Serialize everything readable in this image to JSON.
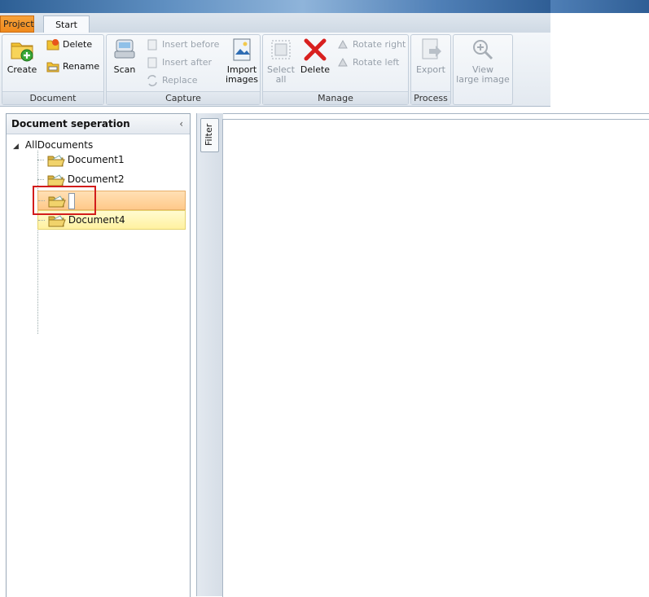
{
  "tabs": {
    "project": "Project",
    "start": "Start"
  },
  "ribbon": {
    "document": {
      "label": "Document",
      "create": "Create",
      "delete": "Delete",
      "rename": "Rename"
    },
    "capture": {
      "label": "Capture",
      "scan": "Scan",
      "insert_before": "Insert before",
      "insert_after": "Insert after",
      "replace": "Replace",
      "import_line1": "Import",
      "import_line2": "images"
    },
    "manage": {
      "label": "Manage",
      "select_line1": "Select",
      "select_line2": "all",
      "delete": "Delete",
      "rotate_right": "Rotate right",
      "rotate_left": "Rotate left"
    },
    "process": {
      "label": "Process",
      "export": "Export"
    },
    "view": {
      "line1": "View",
      "line2": "large image"
    }
  },
  "left_panel": {
    "title": "Document seperation",
    "collapse_glyph": "‹",
    "tree": {
      "root": "AllDocuments",
      "items": [
        {
          "label": "Document1",
          "state": "normal"
        },
        {
          "label": "Document2",
          "state": "normal"
        },
        {
          "label": "",
          "state": "editing"
        },
        {
          "label": "Document4",
          "state": "hover"
        }
      ]
    }
  },
  "filter": {
    "label": "Filter"
  },
  "colors": {
    "project_tab": "#ef8a1e",
    "selection": "#ffc98a",
    "hover": "#fff1a0",
    "highlight_box": "#d21c1c"
  }
}
